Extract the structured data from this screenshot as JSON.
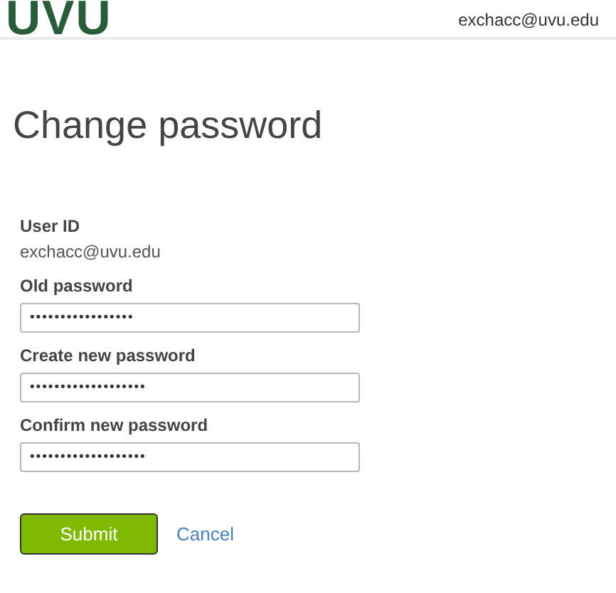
{
  "header": {
    "logo": "UVU",
    "account": "exchacc@uvu.edu"
  },
  "title": "Change password",
  "user_id": {
    "label": "User ID",
    "value": "exchacc@uvu.edu"
  },
  "fields": [
    {
      "label": "Old password",
      "value": "•••••••••••••••••"
    },
    {
      "label": "Create new password",
      "value": "•••••••••••••••••••"
    },
    {
      "label": "Confirm new password",
      "value": "•••••••••••••••••••"
    }
  ],
  "buttons": {
    "submit": "Submit",
    "cancel": "Cancel"
  }
}
